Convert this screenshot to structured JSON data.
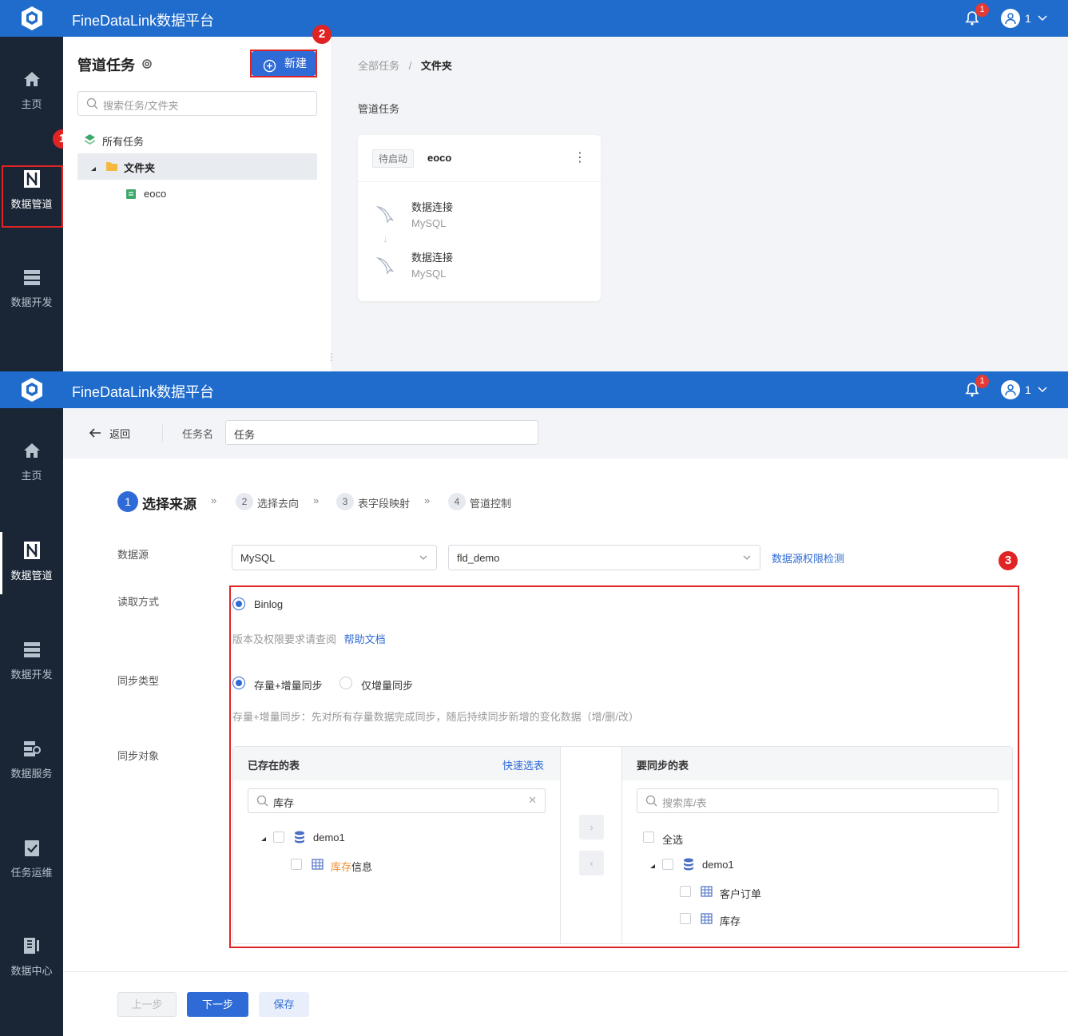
{
  "app": {
    "title": "FineDataLink数据平台",
    "notifications": "1",
    "user": "1"
  },
  "nav": {
    "top": [
      {
        "label": "主页",
        "icon": "home-icon"
      },
      {
        "label": "数据管道",
        "icon": "pipeline-icon"
      },
      {
        "label": "数据开发",
        "icon": "dev-icon"
      }
    ],
    "bottom": [
      {
        "label": "主页",
        "icon": "home-icon"
      },
      {
        "label": "数据管道",
        "icon": "pipeline-icon"
      },
      {
        "label": "数据开发",
        "icon": "dev-icon"
      },
      {
        "label": "数据服务",
        "icon": "service-icon"
      },
      {
        "label": "任务运维",
        "icon": "ops-icon"
      },
      {
        "label": "数据中心",
        "icon": "center-icon"
      }
    ]
  },
  "callouts": {
    "one": "1",
    "two": "2",
    "three": "3"
  },
  "tasks_panel": {
    "title": "管道任务",
    "new_button": "新建",
    "search_placeholder": "搜索任务/文件夹",
    "tree": {
      "all": "所有任务",
      "folder": "文件夹",
      "task": "eoco"
    }
  },
  "main_top": {
    "breadcrumb": {
      "root": "全部任务",
      "sep": "/",
      "current": "文件夹"
    },
    "section_title": "管道任务",
    "card": {
      "status": "待启动",
      "name": "eoco",
      "source_label": "数据连接",
      "source_type": "MySQL",
      "target_label": "数据连接",
      "target_type": "MySQL"
    }
  },
  "editor": {
    "back": "返回",
    "task_name_label": "任务名",
    "task_name_value": "任务",
    "steps": [
      {
        "num": "1",
        "label": "选择来源"
      },
      {
        "num": "2",
        "label": "选择去向"
      },
      {
        "num": "3",
        "label": "表字段映射"
      },
      {
        "num": "4",
        "label": "管道控制"
      }
    ],
    "datasource_label": "数据源",
    "datasource_type": "MySQL",
    "datasource_db": "fld_demo",
    "permission_check": "数据源权限检测",
    "read_mode_label": "读取方式",
    "read_mode": "Binlog",
    "help_hint": "版本及权限要求请查阅",
    "help_link": "帮助文档",
    "sync_type_label": "同步类型",
    "sync_full": "存量+增量同步",
    "sync_incr": "仅增量同步",
    "sync_desc": "存量+增量同步：先对所有存量数据完成同步，随后持续同步新增的变化数据（增/删/改）",
    "sync_object_label": "同步对象",
    "left_list": {
      "title": "已存在的表",
      "quick_select": "快速选表",
      "search_value": "库存",
      "db": "demo1",
      "table_highlight": "库存",
      "table_rest": "信息"
    },
    "right_list": {
      "title": "要同步的表",
      "search_placeholder": "搜索库/表",
      "select_all": "全选",
      "db": "demo1",
      "tables": [
        "客户订单",
        "库存"
      ]
    },
    "footer": {
      "prev": "上一步",
      "next": "下一步",
      "save": "保存"
    }
  }
}
